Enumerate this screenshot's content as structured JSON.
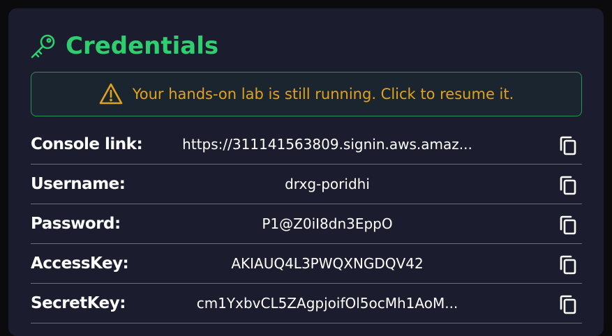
{
  "header": {
    "title": "Credentials",
    "icon": "key-icon",
    "title_color": "#2fce6f"
  },
  "banner": {
    "icon": "warning-icon",
    "text": "Your hands-on lab is still running. Click to resume it.",
    "text_color": "#e1a31b",
    "border_color": "#26955a"
  },
  "credentials": [
    {
      "label": "Console link:",
      "value": "https://311141563809.signin.aws.amaz...",
      "copy_icon": "copy-icon"
    },
    {
      "label": "Username:",
      "value": "drxg-poridhi",
      "copy_icon": "copy-icon"
    },
    {
      "label": "Password:",
      "value": "P1@Z0iI8dn3EppO",
      "copy_icon": "copy-icon"
    },
    {
      "label": "AccessKey:",
      "value": "AKIAUQ4L3PWQXNGDQV42",
      "copy_icon": "copy-icon"
    },
    {
      "label": "SecretKey:",
      "value": "cm1YxbvCL5ZAgpjoifOl5ocMh1AoM...",
      "copy_icon": "copy-icon"
    }
  ],
  "colors": {
    "page_background": "#0b0b0d",
    "panel_background": "#1b1d2e",
    "divider": "#6a6d7e"
  }
}
